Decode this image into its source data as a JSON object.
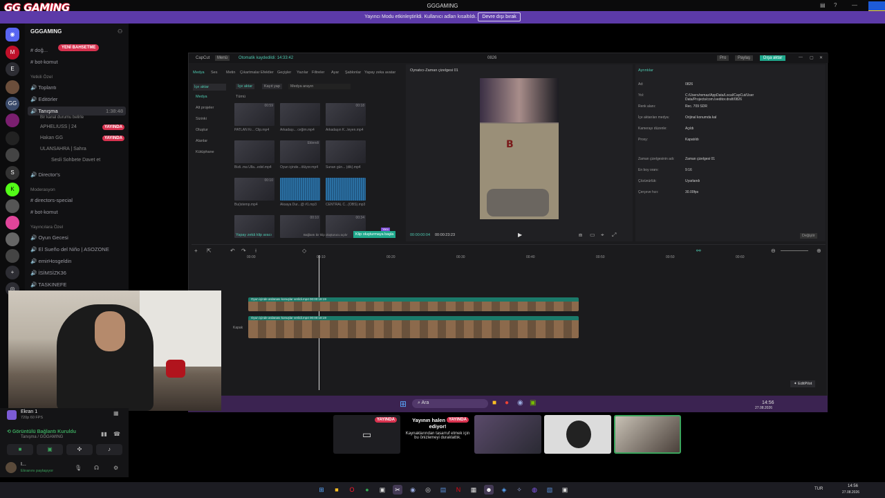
{
  "window": {
    "title": "GGGAMING",
    "logo": "GG GAMING"
  },
  "stream_banner": {
    "text": "Yayıncı Modu etkinleştirildi. Kullanıcı adları kısaltıldı.",
    "button": "Devre dışı bırak"
  },
  "servers": [
    {
      "label": "M"
    },
    {
      "label": "E"
    },
    {
      "label": "GG"
    },
    {
      "label": "S"
    },
    {
      "label": "K"
    }
  ],
  "sidebar": {
    "guild_name": "GGGAMING",
    "pill": "YENİ BAHSETME",
    "channels_top": [
      {
        "label": "doğ..."
      },
      {
        "label": "bot-komut"
      }
    ],
    "cat_yetkili": "Yetkili Özel",
    "toplanti": "Toplantı",
    "editorler": "Editörler",
    "tanisma": {
      "label": "Tanışma",
      "time": "1:38:48",
      "sub": "Bir kanal durumu belirle"
    },
    "members": [
      {
        "name": "APHELIUSS | 24",
        "badge": "YAYINDA"
      },
      {
        "name": "Hakan GG",
        "badge": "YAYINDA"
      },
      {
        "name": "ULANSAHRA | Sahra",
        "badge": ""
      }
    ],
    "invite": "Sesli Sohbete Davet et",
    "directors": "Director's",
    "cat_mod": "Moderasyon",
    "mod_channels": [
      "directors-special",
      "bot-komut"
    ],
    "cat_yayin": "Yayıncılara Özel",
    "voice_channels": [
      "Oyun Gecesi",
      "El Sueño del Niño | ASOZONE",
      "emirHosgeldin",
      "İSİMSİZK36",
      "TASKINEFE"
    ]
  },
  "voice_panel": {
    "screen": "Ekran 1",
    "screen_sub": "720p 60 FPS",
    "status": "Görüntülü Bağlantı Kuruldu",
    "path": "Tanışma / GGGAMING",
    "user": "I...",
    "user_sub": "Ekranını paylaşıyor"
  },
  "capcut": {
    "app": "CapCut",
    "menu": "Menü",
    "autosave": "Otomatik kaydedildi: 14:33:42",
    "project": "0826",
    "pro": "Pro",
    "share": "Paylaş",
    "export": "Dışa aktar",
    "toolbar": [
      "Medya",
      "Ses",
      "Metin",
      "Çıkartmalar",
      "Efektler",
      "Geçişler",
      "Yazılar",
      "Filtreler",
      "Ayar",
      "Şablonlar",
      "Yapay zeka avatar"
    ],
    "left_nav": [
      "İçe aktar",
      "Medya",
      "Alt projeler",
      "Sizinki",
      "Oluştur",
      "Alanlar",
      "Kütüphane"
    ],
    "media_tabs": {
      "import": "İçe aktar",
      "record": "Kayıt yap",
      "search": "Medya arayın",
      "all": "Tümü"
    },
    "media": [
      {
        "name": "PATLAN Kr... Clip.mp4",
        "dur": "00:59",
        "au": false
      },
      {
        "name": "Arkadaşı... ceğim.mp4",
        "dur": "",
        "au": false
      },
      {
        "name": "Arkadaşın K...leyen.mp4",
        "dur": "00:18",
        "au": false
      },
      {
        "name": "Bizli..ma Ulla...edel.mp4",
        "dur": "",
        "au": false
      },
      {
        "name": "Oyun içinde...ölüyor.mp4",
        "dur": "Eklendi",
        "au": false
      },
      {
        "name": "Sunan gün... (dik).mp4",
        "dur": "",
        "au": false
      },
      {
        "name": "Bu(istemp.mp4",
        "dur": "00:10",
        "au": false
      },
      {
        "name": "Aksaya Dur...@ #1.mp3",
        "dur": "",
        "au": true
      },
      {
        "name": "CENTRAL C...(OBS).mp3",
        "dur": "",
        "au": true
      },
      {
        "name": "",
        "dur": "",
        "au": false
      },
      {
        "name": "",
        "dur": "00:10",
        "au": false
      },
      {
        "name": "",
        "dur": "00:34",
        "au": false
      }
    ],
    "ai_clip": "Yapay zekâ klip aracı",
    "ai_hint": "Bağlantı bir klip oluşturucu açılır",
    "ai_start": "Klip oluşturmaya başla",
    "ai_new": "Yeni",
    "player_title": "Oynatıcı-Zaman çizelgesi 01",
    "time_cur": "00:00:00:04",
    "time_total": "00:00:23:23",
    "details_title": "Ayrıntılar",
    "details": [
      {
        "k": "Ad:",
        "v": "0826"
      },
      {
        "k": "Yol:",
        "v": "C:/Users/remaz/AppData/Local/CapCut/User Data/Projects/com.lveditor.draft/0826"
      },
      {
        "k": "Renk alanı:",
        "v": "Rec. 709 SDR"
      },
      {
        "k": "İçe aktarılan medya:",
        "v": "Orijinal konumda kal"
      },
      {
        "k": "Kamerayı düzenle:",
        "v": "Açıldı"
      },
      {
        "k": "Proxy:",
        "v": "Kapatıldı"
      },
      {
        "k": "Zaman çizelgesinin adı:",
        "v": "Zaman çizelgesi 01"
      },
      {
        "k": "En boy oranı:",
        "v": "9:16"
      },
      {
        "k": "Çözünürlük:",
        "v": "Uyarlandı"
      },
      {
        "k": "Çerçeve hızı:",
        "v": "30.00fps"
      }
    ],
    "modify": "Değiştir",
    "ruler": [
      "00:00",
      "00:10",
      "00:20",
      "00:30",
      "00:40",
      "00:50",
      "00:50",
      "00:60"
    ],
    "clip_label": "Oyun içinde ardanası konuşlar verildi.mp4  00:00:18:19",
    "cover": "Kapak",
    "editpilot": "EditPilot"
  },
  "inner_taskbar": {
    "search": "Ara",
    "time": "14:56",
    "date": "27.08.2026"
  },
  "preview": {
    "notice_title": "Yayının halen devam ediyor!",
    "notice_body": "Kaynaklarından tasarruf etmek için bu önizlemeyi duraklattık.",
    "badge": "YAYINDA"
  },
  "taskbar": {
    "lang": "TUR",
    "time": "14:56",
    "date": "27.08.2026"
  }
}
